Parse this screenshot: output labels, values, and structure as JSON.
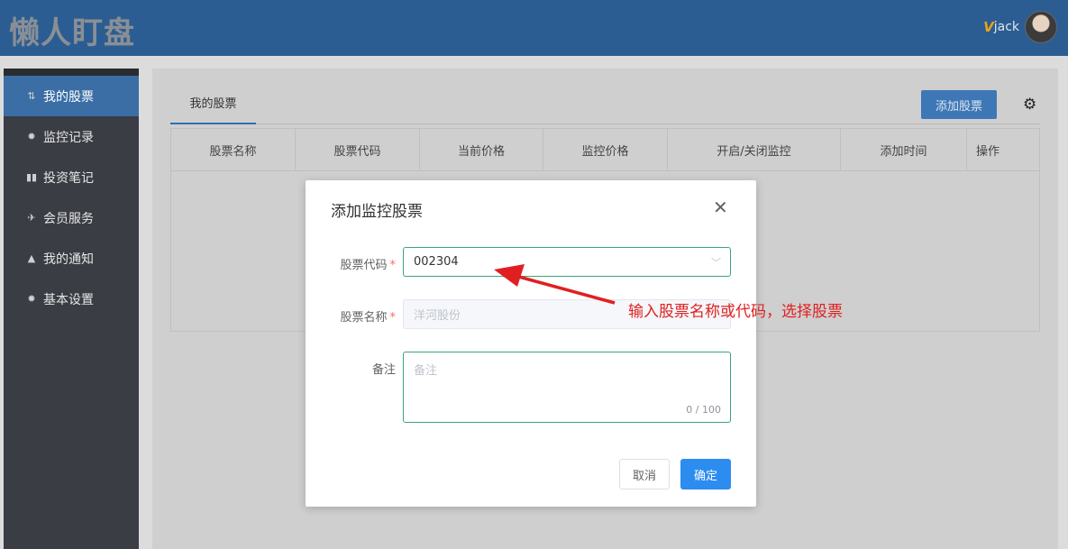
{
  "header": {
    "logo": "懒人盯盘",
    "vip_badge": "V",
    "username": "jack"
  },
  "sidebar": {
    "items": [
      {
        "label": "我的股票",
        "icon": "sliders-icon",
        "active": true
      },
      {
        "label": "监控记录",
        "icon": "gear-icon"
      },
      {
        "label": "投资笔记",
        "icon": "book-icon"
      },
      {
        "label": "会员服务",
        "icon": "plane-icon"
      },
      {
        "label": "我的通知",
        "icon": "bell-icon"
      },
      {
        "label": "基本设置",
        "icon": "gear-icon"
      }
    ]
  },
  "main": {
    "tab": "我的股票",
    "add_button": "添加股票",
    "settings_icon": "gear-icon",
    "columns": [
      "股票名称",
      "股票代码",
      "当前价格",
      "监控价格",
      "开启/关闭监控",
      "添加时间",
      "操作"
    ]
  },
  "dialog": {
    "title": "添加监控股票",
    "close_icon": "close-icon",
    "code_label": "股票代码",
    "code_value": "002304",
    "name_label": "股票名称",
    "name_value": "洋河股份",
    "note_label": "备注",
    "note_placeholder": "备注",
    "note_counter": "0 / 100",
    "cancel": "取消",
    "confirm": "确定"
  },
  "annotation": {
    "text": "输入股票名称或代码，选择股票",
    "color": "#e02020"
  }
}
